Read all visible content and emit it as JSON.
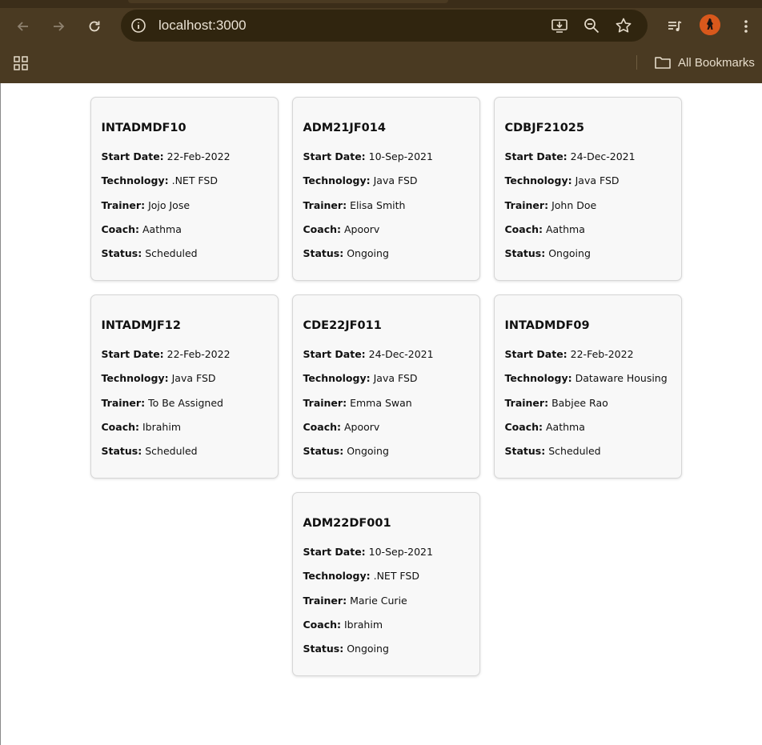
{
  "browser": {
    "url": "localhost:3000",
    "bookmarks_label": "All Bookmarks"
  },
  "field_labels": {
    "start_date": "Start Date:",
    "technology": "Technology:",
    "trainer": "Trainer:",
    "coach": "Coach:",
    "status": "Status:"
  },
  "cohorts": [
    {
      "code": "INTADMDF10",
      "start_date": "22-Feb-2022",
      "technology": ".NET FSD",
      "trainer": "Jojo Jose",
      "coach": "Aathma",
      "status": "Scheduled"
    },
    {
      "code": "ADM21JF014",
      "start_date": "10-Sep-2021",
      "technology": "Java FSD",
      "trainer": "Elisa Smith",
      "coach": "Apoorv",
      "status": "Ongoing"
    },
    {
      "code": "CDBJF21025",
      "start_date": "24-Dec-2021",
      "technology": "Java FSD",
      "trainer": "John Doe",
      "coach": "Aathma",
      "status": "Ongoing"
    },
    {
      "code": "INTADMJF12",
      "start_date": "22-Feb-2022",
      "technology": "Java FSD",
      "trainer": "To Be Assigned",
      "coach": "Ibrahim",
      "status": "Scheduled"
    },
    {
      "code": "CDE22JF011",
      "start_date": "24-Dec-2021",
      "technology": "Java FSD",
      "trainer": "Emma Swan",
      "coach": "Apoorv",
      "status": "Ongoing"
    },
    {
      "code": "INTADMDF09",
      "start_date": "22-Feb-2022",
      "technology": "Dataware Housing",
      "trainer": "Babjee Rao",
      "coach": "Aathma",
      "status": "Scheduled"
    },
    {
      "code": "ADM22DF001",
      "start_date": "10-Sep-2021",
      "technology": ".NET FSD",
      "trainer": "Marie Curie",
      "coach": "Ibrahim",
      "status": "Ongoing"
    }
  ]
}
